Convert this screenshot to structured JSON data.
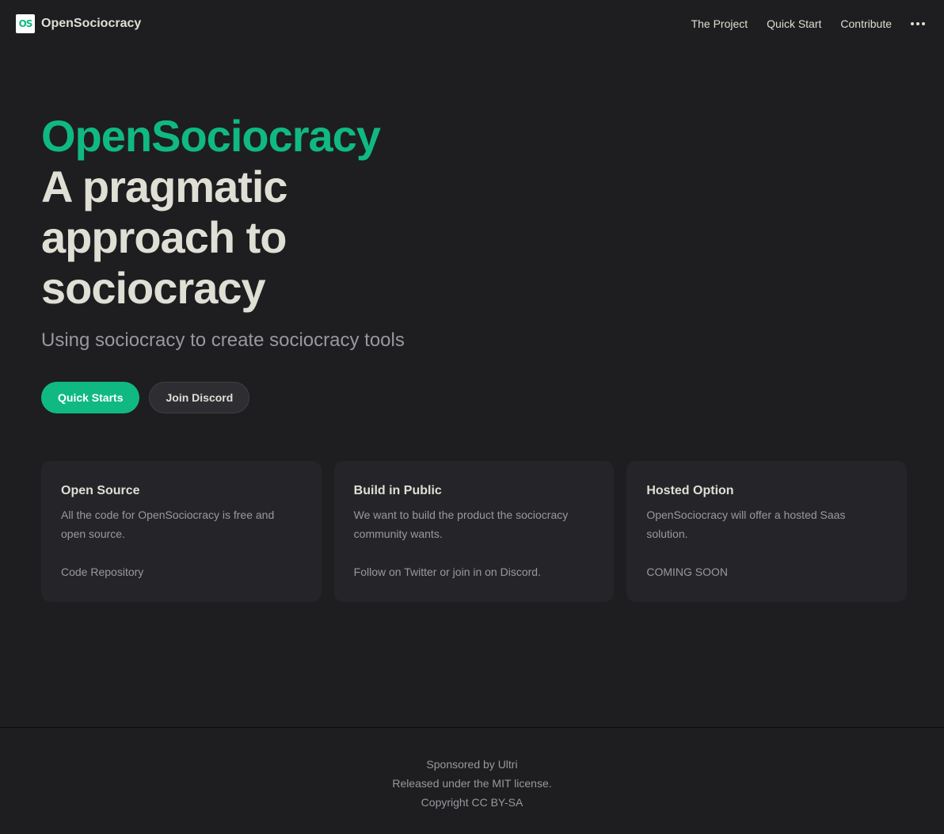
{
  "nav": {
    "logo_mark": "OS",
    "site_title": "OpenSociocracy",
    "links": [
      "The Project",
      "Quick Start",
      "Contribute"
    ]
  },
  "hero": {
    "name": "OpenSociocracy",
    "text": "A pragmatic approach to sociocracy",
    "tagline": "Using sociocracy to create sociocracy tools",
    "actions": [
      "Quick Starts",
      "Join Discord"
    ]
  },
  "features": [
    {
      "title": "Open Source",
      "details": "All the code for OpenSociocracy is free and open source.",
      "link": "Code Repository"
    },
    {
      "title": "Build in Public",
      "details": "We want to build the product the sociocracy community wants.",
      "link": "Follow on Twitter or join in on Discord."
    },
    {
      "title": "Hosted Option",
      "details": "OpenSociocracy will offer a hosted Saas solution.",
      "link": "COMING SOON"
    }
  ],
  "footer": {
    "lines": [
      "Sponsored by Ultri",
      "Released under the MIT license.",
      "Copyright CC BY-SA"
    ]
  },
  "colors": {
    "brand": "#10b981",
    "background": "#1e1e20",
    "card": "#252529",
    "text": "#dfdfd6",
    "muted": "#98989f"
  },
  "icons": [
    "logo-icon",
    "more-icon"
  ]
}
